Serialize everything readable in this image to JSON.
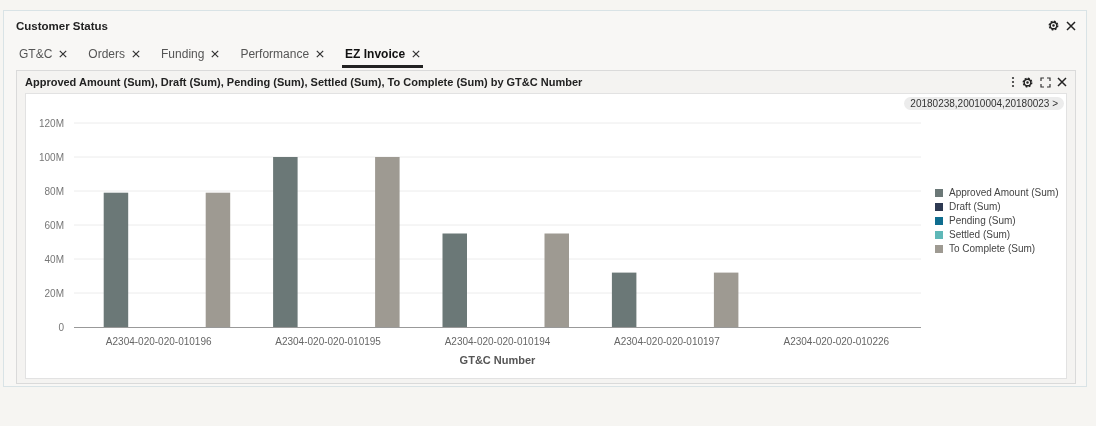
{
  "window": {
    "title": "Customer Status"
  },
  "tabs": [
    {
      "label": "GT&C",
      "selected": false
    },
    {
      "label": "Orders",
      "selected": false
    },
    {
      "label": "Funding",
      "selected": false
    },
    {
      "label": "Performance",
      "selected": false
    },
    {
      "label": "EZ Invoice",
      "selected": true
    }
  ],
  "card": {
    "title": "Approved Amount (Sum), Draft (Sum), Pending (Sum), Settled (Sum), To Complete (Sum) by GT&C Number",
    "filter": "20180238,20010004,20180023 >",
    "chart_data": {
      "type": "bar",
      "grid": true,
      "xlabel": "GT&C Number",
      "categories": [
        "A2304-020-020-010196",
        "A2304-020-020-010195",
        "A2304-020-020-010194",
        "A2304-020-020-010197",
        "A2304-020-020-010226"
      ],
      "series": [
        {
          "name": "Approved Amount (Sum)",
          "color": "#6b7877",
          "values": [
            79,
            100,
            55,
            32,
            null
          ]
        },
        {
          "name": "Draft (Sum)",
          "color": "#2e3a52",
          "values": [
            null,
            null,
            null,
            null,
            null
          ]
        },
        {
          "name": "Pending (Sum)",
          "color": "#0f6d8f",
          "values": [
            null,
            null,
            null,
            null,
            null
          ]
        },
        {
          "name": "Settled (Sum)",
          "color": "#5fb8b8",
          "values": [
            null,
            null,
            null,
            null,
            null
          ]
        },
        {
          "name": "To Complete (Sum)",
          "color": "#9e9a92",
          "values": [
            79,
            100,
            55,
            32,
            null
          ]
        }
      ],
      "ylim": [
        0,
        120
      ],
      "yticks": [
        {
          "value": 0,
          "label": "0"
        },
        {
          "value": 20,
          "label": "20M"
        },
        {
          "value": 40,
          "label": "40M"
        },
        {
          "value": 60,
          "label": "60M"
        },
        {
          "value": 80,
          "label": "80M"
        },
        {
          "value": 100,
          "label": "100M"
        },
        {
          "value": 120,
          "label": "120M"
        }
      ]
    }
  }
}
